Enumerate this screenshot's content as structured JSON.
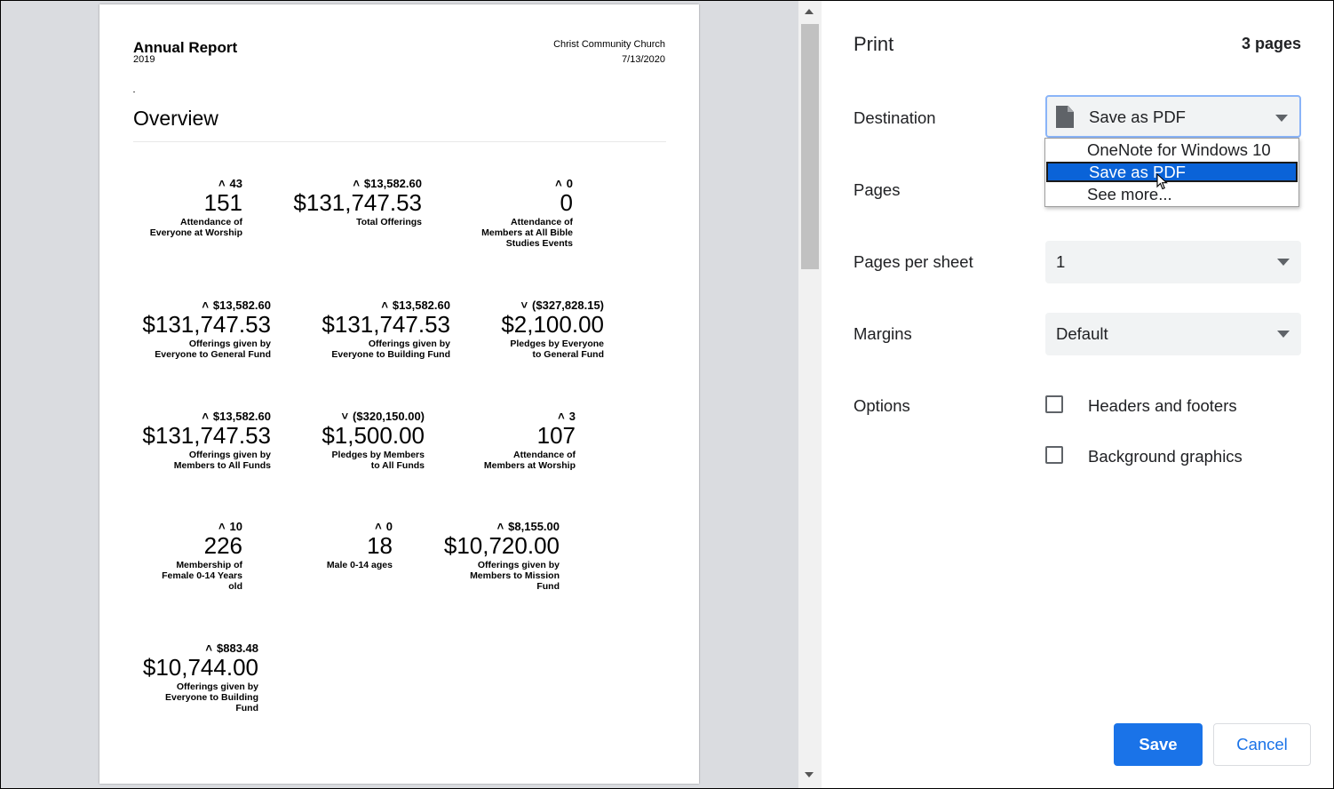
{
  "report": {
    "title": "Annual Report",
    "year": "2019",
    "organization": "Christ Community Church",
    "date": "7/13/2020",
    "section_title": "Overview",
    "metrics": [
      {
        "delta": "43",
        "direction": "up",
        "value": "151",
        "label": "Attendance of\nEveryone at Worship"
      },
      {
        "delta": "$13,582.60",
        "direction": "up",
        "value": "$131,747.53",
        "label": "Total Offerings"
      },
      {
        "delta": "0",
        "direction": "up",
        "value": "0",
        "label": "Attendance of\nMembers at All Bible\nStudies Events"
      },
      {
        "delta": "$13,582.60",
        "direction": "up",
        "value": "$131,747.53",
        "label": "Offerings given by\nEveryone to General Fund"
      },
      {
        "delta": "$13,582.60",
        "direction": "up",
        "value": "$131,747.53",
        "label": "Offerings given by\nEveryone to Building Fund"
      },
      {
        "delta": "($327,828.15)",
        "direction": "down",
        "value": "$2,100.00",
        "label": "Pledges by Everyone\nto General Fund"
      },
      {
        "delta": "$13,582.60",
        "direction": "up",
        "value": "$131,747.53",
        "label": "Offerings given by\nMembers to All Funds"
      },
      {
        "delta": "($320,150.00)",
        "direction": "down",
        "value": "$1,500.00",
        "label": "Pledges by Members\nto All Funds"
      },
      {
        "delta": "3",
        "direction": "up",
        "value": "107",
        "label": "Attendance of\nMembers at Worship"
      },
      {
        "delta": "10",
        "direction": "up",
        "value": "226",
        "label": "Membership of\nFemale 0-14 Years\nold"
      },
      {
        "delta": "0",
        "direction": "up",
        "value": "18",
        "label": "Male 0-14 ages"
      },
      {
        "delta": "$8,155.00",
        "direction": "up",
        "value": "$10,720.00",
        "label": "Offerings given by\nMembers to Mission\nFund"
      },
      {
        "delta": "$883.48",
        "direction": "up",
        "value": "$10,744.00",
        "label": "Offerings given by\nEveryone to Building\nFund"
      }
    ]
  },
  "print_panel": {
    "title": "Print",
    "page_count": "3 pages",
    "destination_label": "Destination",
    "destination_value": "Save as PDF",
    "destination_icon": "document-icon",
    "destination_options": [
      "OneNote for Windows 10",
      "Save as PDF",
      "See more..."
    ],
    "pages_label": "Pages",
    "pages_per_sheet_label": "Pages per sheet",
    "pages_per_sheet_value": "1",
    "margins_label": "Margins",
    "margins_value": "Default",
    "options_label": "Options",
    "option_headers_footers": "Headers and footers",
    "option_background_graphics": "Background graphics",
    "save_label": "Save",
    "cancel_label": "Cancel",
    "accent_color": "#1a73e8"
  }
}
